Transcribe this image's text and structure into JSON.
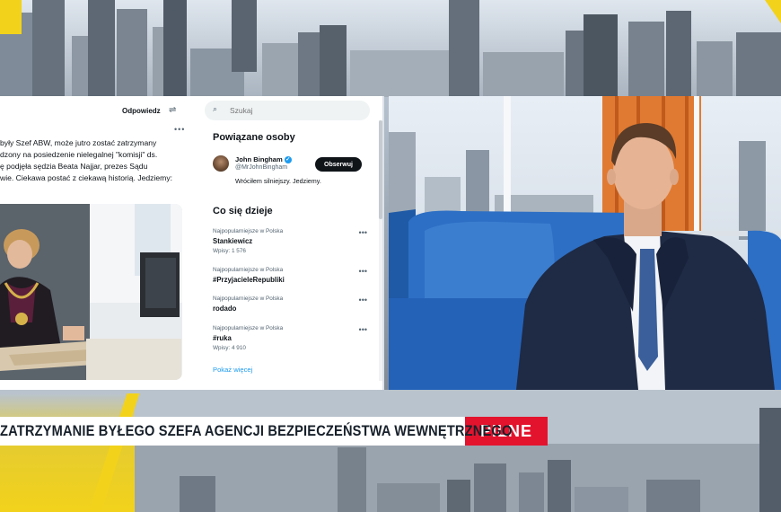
{
  "tweet": {
    "reply_label": "Odpowiedz",
    "text_lines": [
      " były Szef ABW, może jutro zostać zatrzymany",
      "dzony na posiedzenie nielegalnej \"komisji\" ds.",
      "ę podjęła sędzia Beata Najjar, prezes Sądu",
      "wie. Ciekawa postać z ciekawą historią. Jedziemy:"
    ]
  },
  "sidebar": {
    "search_placeholder": "Szukaj",
    "related_heading": "Powiązane osoby",
    "person": {
      "name": "John Bingham",
      "handle": "@MrJohnBingham",
      "bio": "Wróciłem silniejszy. Jedziemy.",
      "follow_label": "Obserwuj"
    },
    "trends_heading": "Co się dzieje",
    "trends": [
      {
        "category": "Najpopularniejsze w Polska",
        "name": "Stankiewicz",
        "posts": "Wpisy: 1 576"
      },
      {
        "category": "Najpopularniejsze w Polska",
        "name": "#PrzyjacieleRepubliki",
        "posts": ""
      },
      {
        "category": "Najpopularniejsze w Polska",
        "name": "rodado",
        "posts": ""
      },
      {
        "category": "Najpopularniejsze w Polska",
        "name": "#ruka",
        "posts": "Wpisy: 4 910"
      }
    ],
    "show_more": "Pokaż więcej"
  },
  "ticker": {
    "headline": "ZATRZYMANIE BYŁEGO SZEFA AGENCJI BEZPIECZEŃSTWA WEWNĘTRZNEGO",
    "badge": "PILNE"
  },
  "colors": {
    "accent_yellow": "#f2d21b",
    "badge_red": "#e3132d",
    "link_blue": "#1d9bf0"
  }
}
